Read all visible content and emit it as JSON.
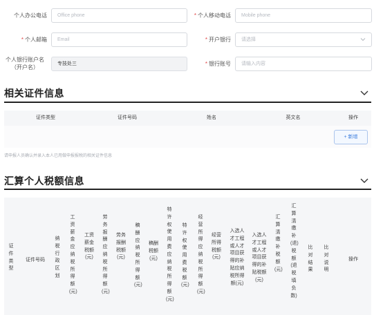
{
  "form": {
    "office_phone": {
      "label": "个人办公电话",
      "placeholder": "Office phone"
    },
    "mobile_phone": {
      "label": "个人移动电话",
      "placeholder": "Mobile phone"
    },
    "email": {
      "label": "个人邮箱",
      "placeholder": "Email"
    },
    "bank": {
      "label": "开户银行",
      "placeholder": "请选择"
    },
    "account_name": {
      "label_line1": "个人银行账户名",
      "label_line2": "（开户名）",
      "value": "专技处三"
    },
    "account_no": {
      "label": "银行账号",
      "placeholder": "请输入内容"
    },
    "required_mark": "*"
  },
  "cert_section": {
    "title": "相关证件信息",
    "columns": [
      "证件类型",
      "证件号码",
      "姓名",
      "英文名",
      "操作"
    ],
    "add_button": "+ 新增",
    "note": "请申报人员确认并录入本人已用做申报报税的相关证件信息"
  },
  "tax_section": {
    "title": "汇算个人税额信息",
    "columns": [
      "证件类型",
      "证件号码",
      "纳税行政区划",
      "工资薪金应纳税所得额(元)",
      "工资薪金税额(元)",
      "劳务报酬应纳税所得额(元)",
      "劳务报酬税额(元)",
      "稿酬应纳税所得额(元)",
      "稿酬税额(元)",
      "特许权使用费应纳税所得额(元)",
      "特许权使用费税额(元)",
      "经营所得应纳税所得额(元)",
      "经营所得税额(元)",
      "入选人才工程或人才项目获得的补贴应纳税所得额(元)",
      "入选人才工程或人才项目获得的补贴税额(元)",
      "汇算清缴补税额(元)",
      "汇算清缴补(退)税额(退税填负数)",
      "比对结果",
      "比对说明",
      "操作"
    ]
  }
}
